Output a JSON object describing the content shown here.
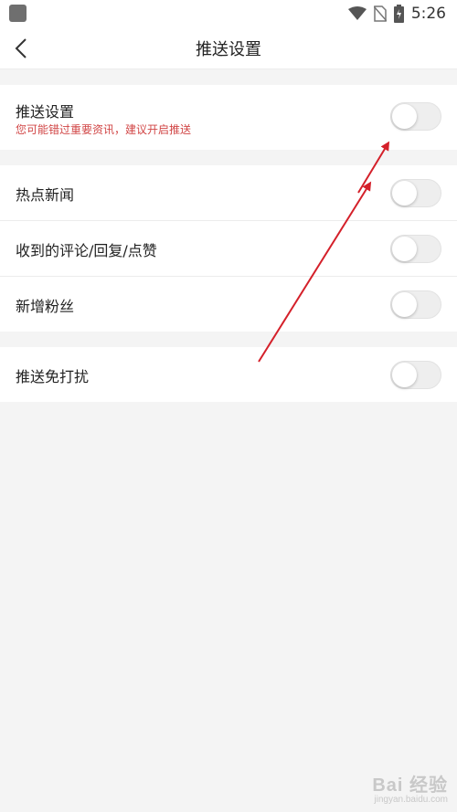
{
  "status_bar": {
    "time": "5:26",
    "icons": [
      "app-icon",
      "wifi-icon",
      "no-sim-icon",
      "battery-charging-icon"
    ]
  },
  "header": {
    "title": "推送设置",
    "back_icon": "chevron-left-icon"
  },
  "sections": [
    {
      "rows": [
        {
          "label": "推送设置",
          "subtitle": "您可能错过重要资讯，建议开启推送",
          "enabled": false
        }
      ]
    },
    {
      "rows": [
        {
          "label": "热点新闻",
          "enabled": false
        },
        {
          "label": "收到的评论/回复/点赞",
          "enabled": false
        },
        {
          "label": "新增粉丝",
          "enabled": false
        }
      ]
    },
    {
      "rows": [
        {
          "label": "推送免打扰",
          "enabled": false
        }
      ]
    }
  ],
  "colors": {
    "accent_red": "#d14646",
    "arrow": "#d4202a",
    "background": "#f4f4f4"
  },
  "watermark": {
    "main": "Bai 经验",
    "sub": "jingyan.baidu.com"
  }
}
